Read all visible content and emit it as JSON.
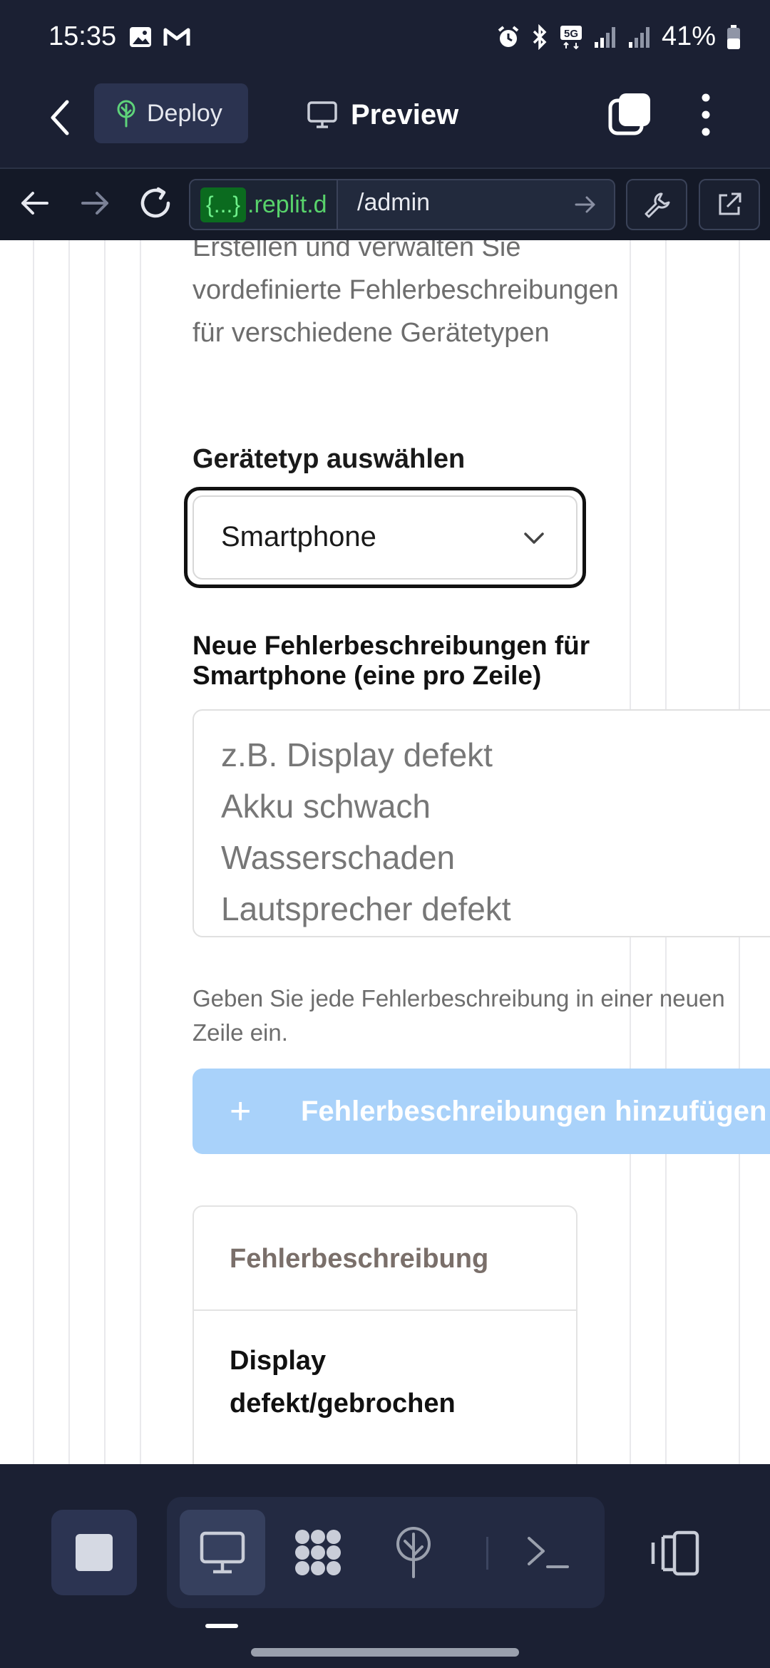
{
  "status_bar": {
    "time": "15:35",
    "battery": "41%",
    "icons": [
      "image-icon",
      "gmail-icon",
      "alarm-icon",
      "bluetooth-icon",
      "5g-icon",
      "signal-icon",
      "signal-icon",
      "battery-icon"
    ]
  },
  "header": {
    "deploy_label": "Deploy",
    "preview_label": "Preview"
  },
  "urlbar": {
    "badge": "{...}",
    "domain": ".replit.d",
    "path": "/admin"
  },
  "page": {
    "intro": "Erstellen und verwalten Sie vordefinierte Fehlerbeschreibungen für verschiedene Gerätetypen",
    "select_label": "Gerätetyp auswählen",
    "select_value": "Smartphone",
    "textarea_label": "Neue Fehlerbeschreibungen für Smartphone (eine pro Zeile)",
    "textarea_placeholder": "z.B. Display defekt\nAkku schwach\nWasserschaden\nLautsprecher defekt",
    "help_text": "Geben Sie jede Fehlerbeschreibung in einer neuen Zeile ein.",
    "add_button_label": "Fehlerbeschreibungen hinzufügen",
    "table": {
      "header": "Fehlerbeschreibung",
      "rows": [
        "Display defekt/gebrochen"
      ]
    }
  },
  "colors": {
    "chrome": "#1b2033",
    "accent_button": "#a9d2fa",
    "url_green": "#58d36b"
  }
}
